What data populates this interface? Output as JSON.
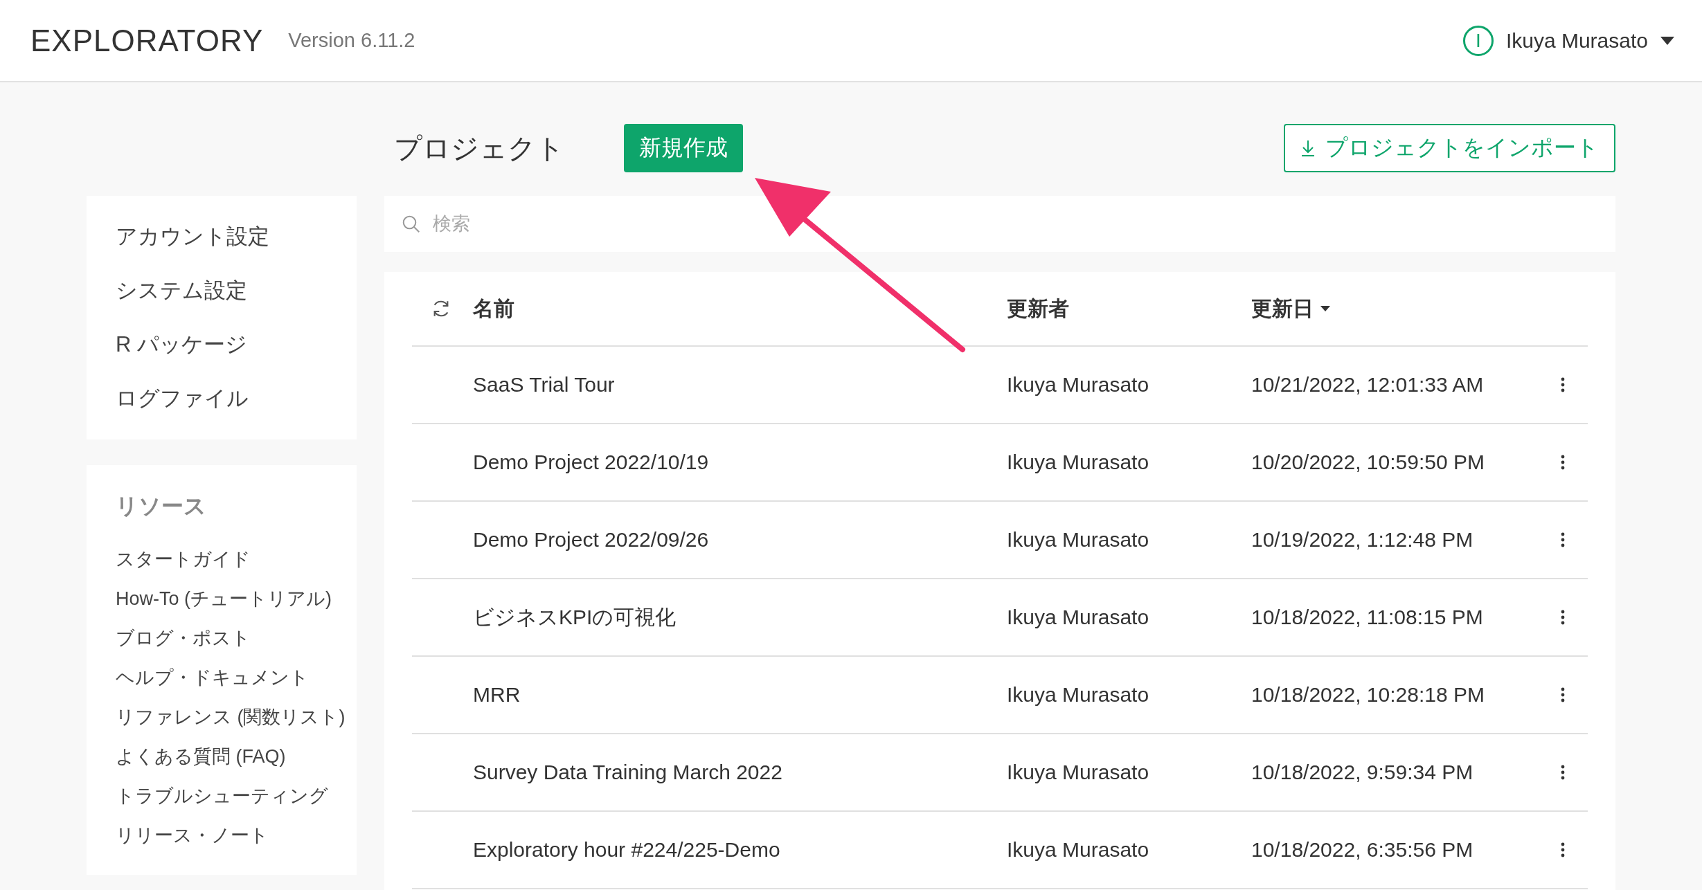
{
  "header": {
    "logo": "EXPLORATORY",
    "version": "Version 6.11.2",
    "user": {
      "initial": "I",
      "name": "Ikuya Murasato"
    }
  },
  "sidebar": {
    "settings": [
      "アカウント設定",
      "システム設定",
      "R パッケージ",
      "ログファイル"
    ],
    "resources": {
      "title": "リソース",
      "items": [
        "スタートガイド",
        "How-To (チュートリアル)",
        "ブログ・ポスト",
        "ヘルプ・ドキュメント",
        "リファレンス (関数リスト)",
        "よくある質問 (FAQ)",
        "トラブルシューティング",
        "リリース・ノート"
      ]
    }
  },
  "main": {
    "title": "プロジェクト",
    "new_button": "新規作成",
    "import_button": "プロジェクトをインポート",
    "search": {
      "placeholder": "検索"
    },
    "table": {
      "columns": [
        "名前",
        "更新者",
        "更新日"
      ],
      "rows": [
        {
          "name": "SaaS Trial Tour",
          "updater": "Ikuya Murasato",
          "updated": "10/21/2022, 12:01:33 AM"
        },
        {
          "name": "Demo Project 2022/10/19",
          "updater": "Ikuya Murasato",
          "updated": "10/20/2022, 10:59:50 PM"
        },
        {
          "name": "Demo Project 2022/09/26",
          "updater": "Ikuya Murasato",
          "updated": "10/19/2022, 1:12:48 PM"
        },
        {
          "name": "ビジネスKPIの可視化",
          "updater": "Ikuya Murasato",
          "updated": "10/18/2022, 11:08:15 PM"
        },
        {
          "name": "MRR",
          "updater": "Ikuya Murasato",
          "updated": "10/18/2022, 10:28:18 PM"
        },
        {
          "name": "Survey Data Training March 2022",
          "updater": "Ikuya Murasato",
          "updated": "10/18/2022, 9:59:34 PM"
        },
        {
          "name": "Exploratory hour #224/225-Demo",
          "updater": "Ikuya Murasato",
          "updated": "10/18/2022, 6:35:56 PM"
        }
      ]
    }
  }
}
